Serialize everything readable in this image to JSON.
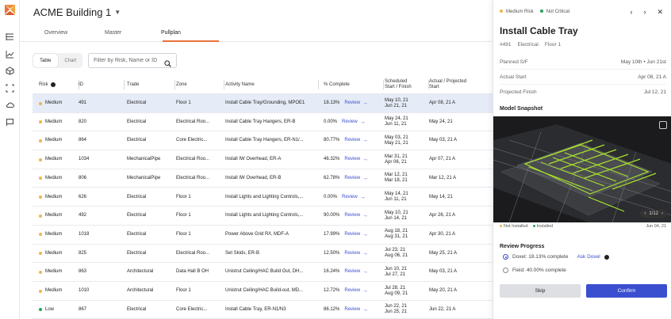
{
  "header": {
    "title": "ACME Building 1"
  },
  "tabs": [
    "Overview",
    "Master",
    "Pullplan"
  ],
  "toolbar": {
    "table_label": "Table",
    "chart_label": "Chart",
    "search_placeholder": "Filter by Risk, Name or ID"
  },
  "columns": [
    "Risk",
    "ID",
    "Trade",
    "Zone",
    "Activity Name",
    "% Complete",
    "Scheduled\nStart / Finish",
    "Actual / Projected\nStart"
  ],
  "rows": [
    {
      "risk": "Medium",
      "id": "491",
      "trade": "Electrical",
      "zone": "Floor 1",
      "activity": "Install Cable Tray/Grounding, MPOE1",
      "pct": "18.13%",
      "sched1": "May 10, 21",
      "sched2": "Jun 21, 21",
      "actual": "Apr 08, 21 A",
      "sel": true
    },
    {
      "risk": "Medium",
      "id": "820",
      "trade": "Electrical",
      "zone": "Electrical Roo...",
      "activity": "Install Cable Tray Hangers, ER-B",
      "pct": "0.00%",
      "sched1": "May 24, 21",
      "sched2": "Jun 11, 21",
      "actual": "May 24, 21"
    },
    {
      "risk": "Medium",
      "id": "864",
      "trade": "Electrical",
      "zone": "Core Electric...",
      "activity": "Install Cable Tray Hangers, ER-N1/...",
      "pct": "80.77%",
      "sched1": "May 03, 21",
      "sched2": "May 21, 21",
      "actual": "May 03, 21 A"
    },
    {
      "risk": "Medium",
      "id": "1034",
      "trade": "MechanicalPipe",
      "zone": "Electrical Roo...",
      "activity": "Install IW Overhead, ER-A",
      "pct": "46.32%",
      "sched1": "Mar 31, 21",
      "sched2": "Apr 06, 21",
      "actual": "Apr 07, 21 A"
    },
    {
      "risk": "Medium",
      "id": "806",
      "trade": "MechanicalPipe",
      "zone": "Electrical Roo...",
      "activity": "Install IW Overhead, ER-B",
      "pct": "62.78%",
      "sched1": "Mar 12, 21",
      "sched2": "Mar 18, 21",
      "actual": "Mar 12, 21 A"
    },
    {
      "risk": "Medium",
      "id": "626",
      "trade": "Electrical",
      "zone": "Floor 1",
      "activity": "Install Lights and Lighting Controls,...",
      "pct": "0.00%",
      "sched1": "May 14, 21",
      "sched2": "Jun 11, 21",
      "actual": "May 14, 21"
    },
    {
      "risk": "Medium",
      "id": "492",
      "trade": "Electrical",
      "zone": "Floor 1",
      "activity": "Install Lights and Lighting Controls,...",
      "pct": "90.00%",
      "sched1": "May 10, 21",
      "sched2": "Jun 14, 21",
      "actual": "Apr 26, 21 A"
    },
    {
      "risk": "Medium",
      "id": "1018",
      "trade": "Electrical",
      "zone": "Floor 1",
      "activity": "Power Above Grid R/I, MDF-A",
      "pct": "17.99%",
      "sched1": "Aug 18, 21",
      "sched2": "Aug 31, 21",
      "actual": "Apr 30, 21 A"
    },
    {
      "risk": "Medium",
      "id": "825",
      "trade": "Electrical",
      "zone": "Electrical Roo...",
      "activity": "Set Skids, ER-B",
      "pct": "12.50%",
      "sched1": "Jul 23, 21",
      "sched2": "Aug 06, 21",
      "actual": "May 25, 21 A"
    },
    {
      "risk": "Medium",
      "id": "863",
      "trade": "Architectural",
      "zone": "Data Hall B OH",
      "activity": "Unistrut Ceiling/HAC Build Out, DH...",
      "pct": "16.24%",
      "sched1": "Jun 10, 21",
      "sched2": "Jul 27, 21",
      "actual": "May 03, 21 A"
    },
    {
      "risk": "Medium",
      "id": "1010",
      "trade": "Architectural",
      "zone": "Floor 1",
      "activity": "Unistrut Ceiling/HAC Build-out, MD...",
      "pct": "12.72%",
      "sched1": "Jul 28, 21",
      "sched2": "Aug 09, 21",
      "actual": "May 20, 21 A"
    },
    {
      "risk": "Low",
      "id": "867",
      "trade": "Electrical",
      "zone": "Core Electric...",
      "activity": "Install Cable Tray, ER-N1/N3",
      "pct": "86.12%",
      "sched1": "Jun 22, 21",
      "sched2": "Jun 25, 21",
      "actual": "Jun 22, 21 A"
    }
  ],
  "review_label": "Review",
  "risk_colors": {
    "Medium": "#f0b44c",
    "Low": "#22a35a"
  },
  "panel": {
    "risk_status": "Medium Risk",
    "critical_status": "Not Critical",
    "title": "Install Cable Tray",
    "meta_id": "#491",
    "meta_trade": "Electrical",
    "meta_zone": "Floor 1",
    "planned_label": "Planned S/F",
    "planned_value": "May 10th • Jun 21st",
    "actual_label": "Actual Start",
    "actual_value": "Apr 08, 21 A",
    "projected_label": "Projected Finish",
    "projected_value": "Jul 12, 21",
    "snapshot_heading": "Model Snapshot",
    "pager": "1/12",
    "legend_not_installed": "Not Installed",
    "legend_installed": "Installed",
    "snapshot_date": "Jun 04, 21",
    "review_heading": "Review Progress",
    "doxel_option": "Doxel: 18.13% complete",
    "ask_label": "Ask Doxel",
    "field_option": "Field: 40.00% complete",
    "skip_label": "Skip",
    "confirm_label": "Confirm"
  }
}
